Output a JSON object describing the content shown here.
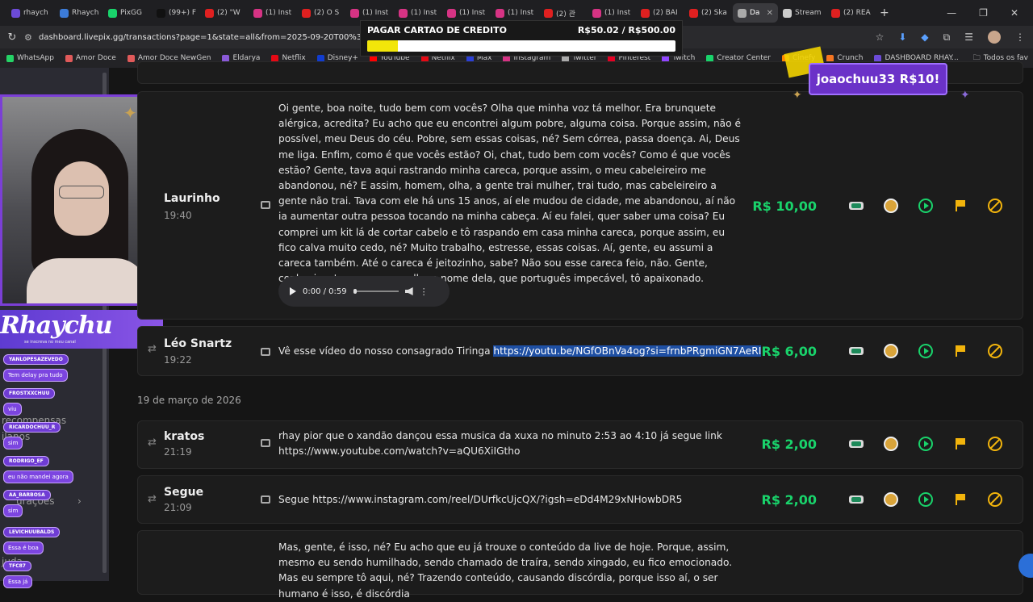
{
  "browser": {
    "tabs": [
      {
        "label": "rhaych",
        "color": "#6c4bd8"
      },
      {
        "label": "Rhaych",
        "color": "#3c7bd8"
      },
      {
        "label": "PixGG",
        "color": "#19d36b"
      },
      {
        "label": "(99+) F",
        "color": "#111111"
      },
      {
        "label": "(2) \"W",
        "color": "#e02020"
      },
      {
        "label": "(1) Inst",
        "color": "#d63384"
      },
      {
        "label": "(2) O S",
        "color": "#e02020"
      },
      {
        "label": "(1) Inst",
        "color": "#d63384"
      },
      {
        "label": "(1) Inst",
        "color": "#d63384"
      },
      {
        "label": "(1) Inst",
        "color": "#d63384"
      },
      {
        "label": "(1) Inst",
        "color": "#d63384"
      },
      {
        "label": "(2) 관",
        "color": "#e02020"
      },
      {
        "label": "(1) Inst",
        "color": "#d63384"
      },
      {
        "label": "(2) BAI",
        "color": "#e02020"
      },
      {
        "label": "(2) Ska",
        "color": "#e02020"
      },
      {
        "label": "Da",
        "color": "#aaaaaa",
        "active": true
      },
      {
        "label": "Stream",
        "color": "#cccccc"
      },
      {
        "label": "(2) REA",
        "color": "#e02020"
      }
    ],
    "url": "dashboard.livepix.gg/transactions?page=1&state=all&from=2025-09-20T00%3A00%3A",
    "bookmarks": [
      {
        "label": "WhatsApp",
        "color": "#25d366"
      },
      {
        "label": "Amor Doce",
        "color": "#e05a5a"
      },
      {
        "label": "Amor Doce NewGen",
        "color": "#e05a5a"
      },
      {
        "label": "Eldarya",
        "color": "#8a5ad8"
      },
      {
        "label": "Netflix",
        "color": "#e50914"
      },
      {
        "label": "Disney+",
        "color": "#113ccf"
      },
      {
        "label": "YouTube",
        "color": "#ff0000"
      },
      {
        "label": "Netflix",
        "color": "#e50914"
      },
      {
        "label": "Max",
        "color": "#2b3fd6"
      },
      {
        "label": "Instagram",
        "color": "#d63384"
      },
      {
        "label": "Twitter",
        "color": "#aaaaaa"
      },
      {
        "label": "Pinterest",
        "color": "#e60023"
      },
      {
        "label": "Twitch",
        "color": "#9146ff"
      },
      {
        "label": "Creator Center",
        "color": "#19d36b"
      },
      {
        "label": "Cinefy",
        "color": "#ff8800"
      },
      {
        "label": "Crunch",
        "color": "#f47521"
      },
      {
        "label": "DASHBOARD RHAY...",
        "color": "#6c4bd8"
      }
    ],
    "bookmarks_right": "Todos os fav"
  },
  "goal": {
    "title": "PAGAR CARTAO DE CREDITO",
    "amount_text": "R$50.02 / R$500.00",
    "progress": 0.1
  },
  "alert": {
    "text": "joaochuu33 R$10!"
  },
  "stream_logo": {
    "text": "Rhaychu",
    "sub": "se inscreva no meu canal"
  },
  "chat": [
    {
      "name": "YANLOPESAZEVEDO",
      "text": "Tem delay pra tudo"
    },
    {
      "name": "FROSTXXCHUU",
      "text": "viu"
    },
    {
      "name": "RICARDOCHUU_R",
      "text": "sim"
    },
    {
      "name": "RODRIGO_EF",
      "text": "eu não mandei agora"
    },
    {
      "name": "AA_BARBOSA",
      "text": "sim"
    },
    {
      "name": "LEVICHUUBALDS",
      "text": "Essa é boa"
    },
    {
      "name": "TFC87",
      "text": "Essa já"
    }
  ],
  "sidebar_faded": [
    "recompensas",
    "ilanos",
    "urações",
    "juda"
  ],
  "transactions": [
    {
      "name": "Laurinho",
      "time": "19:40",
      "message": "Oi gente, boa noite, tudo bem com vocês? Olha que minha voz tá melhor. Era brunquete alérgica, acredita? Eu acho que eu encontrei algum pobre, alguma coisa. Porque assim, não é possível, meu Deus do céu. Pobre, sem essas coisas, né? Sem córrea, passa doença. Ai, Deus me liga. Enfim, como é que vocês estão? Oi, chat, tudo bem com vocês? Como é que vocês estão? Gente, tava aqui rastrando minha careca, porque assim, o meu cabeleireiro me abandonou, né? E assim, homem, olha, a gente trai mulher, trai tudo, mas cabeleireiro a gente não trai. Tava com ele há uns 15 anos, aí ele mudou de cidade, me abandonou, aí não ia aumentar outra pessoa tocando na minha cabeça. Aí eu falei, quer saber uma coisa? Eu comprei um kit lá de cortar cabelo e tô raspando em casa minha careca, porque assim, eu fico calva muito cedo, né? Muito trabalho, estresse, essas coisas. Aí, gente, eu assumi a careca também. Até o careca é jeitozinho, sabe? Não sou esse careca feio, não. Gente, conheci o streamer, cara, olha o nome dela, que português impecável, tô apaixonado.",
      "amount": "R$ 10,00",
      "audio": "0:00 / 0:59"
    },
    {
      "name": "Léo Snartz",
      "time": "19:22",
      "message": "Vê esse vídeo do nosso consagrado Tiringa",
      "link": "https://youtu.be/NGfOBnVa4og?si=frnbPRgmiGN7AeRI",
      "amount": "R$ 6,00"
    },
    {
      "name": "kratos",
      "time": "21:19",
      "message": "rhay pior que o xandão dançou essa musica da xuxa no minuto 2:53 ao 4:10 já segue link https://www.youtube.com/watch?v=aQU6XiIGtho",
      "amount": "R$ 2,00"
    },
    {
      "name": "Segue",
      "time": "21:09",
      "message": "Segue https://www.instagram.com/reel/DUrfkcUjcQX/?igsh=eDd4M29xNHowbDR5",
      "amount": "R$ 2,00"
    },
    {
      "name": "",
      "time": "",
      "message": "Mas, gente, é isso, né? Eu acho que eu já trouxe o conteúdo da live de hoje. Porque, assim, mesmo eu sendo humilhado, sendo chamado de traíra, sendo xingado, eu fico emocionado. Mas eu sempre tô aqui, né? Trazendo conteúdo, causando discórdia, porque isso aí, o ser humano é isso, é discórdia",
      "amount": ""
    }
  ],
  "date_header": "19 de março de 2026",
  "colors": {
    "accent_green": "#19d36b",
    "flag_yellow": "#f2b40c",
    "overlay_purple": "#6b32c8"
  }
}
